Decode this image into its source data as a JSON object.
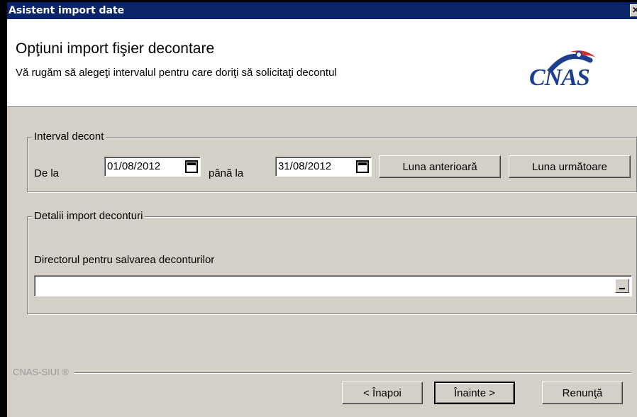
{
  "window": {
    "title": "Asistent import date",
    "close_label": "×"
  },
  "header": {
    "title": "Opţiuni import fişier decontare",
    "subtitle": "Vă rugăm să alegeţi intervalul pentru care doriţi să solicitaţi decontul",
    "logo_text": "CNAS"
  },
  "interval": {
    "legend": "Interval decont",
    "from_label": "De la",
    "from_value": "01/08/2012",
    "to_label": "până la",
    "to_value": "31/08/2012",
    "prev_month_label": "Luna anterioară",
    "next_month_label": "Luna următoare"
  },
  "import_details": {
    "legend": "Detalii import deconturi",
    "dir_label": "Directorul pentru salvarea deconturilor",
    "dir_value": ""
  },
  "footer": {
    "brand": "CNAS-SIUI ®",
    "back_label": "< Înapoi",
    "next_label": "Înainte >",
    "cancel_label": "Renunţă"
  },
  "colors": {
    "titlebar": "#0a246a",
    "dialog_bg": "#d4d0c8",
    "logo_blue": "#1d3e8f",
    "logo_red": "#d32f2f"
  }
}
